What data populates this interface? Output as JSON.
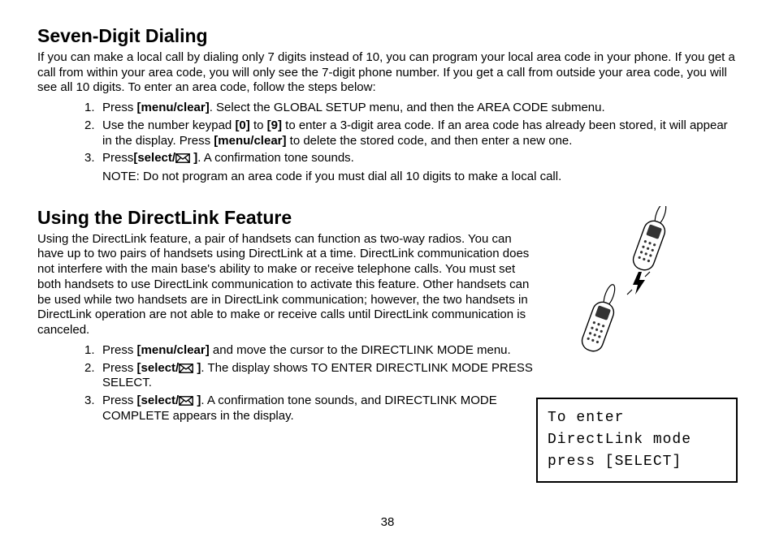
{
  "section1": {
    "heading": "Seven-Digit Dialing",
    "intro": "If you can make a local call by dialing only 7 digits instead of 10, you can program your local area code in your phone. If you get a call from within your area code, you will only see the 7-digit phone number. If you get a call from outside your area code, you will see all 10 digits. To enter an area code, follow the steps below:",
    "steps": [
      {
        "parts": [
          {
            "t": "text",
            "v": "Press "
          },
          {
            "t": "bold",
            "v": "[menu/clear]"
          },
          {
            "t": "text",
            "v": ". Select the GLOBAL SETUP menu, and then the AREA CODE submenu."
          }
        ]
      },
      {
        "parts": [
          {
            "t": "text",
            "v": "Use the number keypad "
          },
          {
            "t": "bold",
            "v": "[0]"
          },
          {
            "t": "text",
            "v": " to "
          },
          {
            "t": "bold",
            "v": "[9]"
          },
          {
            "t": "text",
            "v": " to enter a 3-digit area code. If an area code has already been stored, it will appear in the display. Press "
          },
          {
            "t": "bold",
            "v": "[menu/clear]"
          },
          {
            "t": "text",
            "v": " to delete the stored code, and then enter a new one."
          }
        ]
      },
      {
        "parts": [
          {
            "t": "text",
            "v": "Press"
          },
          {
            "t": "selectkey"
          },
          {
            "t": "text",
            "v": ". A confirmation tone sounds."
          }
        ],
        "note": "NOTE: Do not program an area code if you must dial all 10 digits to make a local call."
      }
    ]
  },
  "section2": {
    "heading": "Using the DirectLink Feature",
    "intro": "Using the DirectLink feature, a pair of handsets can function as two-way radios. You can have up to two pairs of handsets using DirectLink at a time. DirectLink communication does not interfere with the main base's ability to make or receive telephone calls. You must set both handsets to use DirectLink communication to activate this feature. Other handsets can be used while two handsets are in DirectLink communication; however, the two handsets in DirectLink operation are not able to make or receive calls until DirectLink communication is canceled.",
    "steps": [
      {
        "parts": [
          {
            "t": "text",
            "v": "Press "
          },
          {
            "t": "bold",
            "v": "[menu/clear]"
          },
          {
            "t": "text",
            "v": " and move the cursor to the DIRECTLINK MODE menu."
          }
        ]
      },
      {
        "parts": [
          {
            "t": "text",
            "v": "Press "
          },
          {
            "t": "selectkey"
          },
          {
            "t": "text",
            "v": ". The display shows TO ENTER DIRECTLINK MODE PRESS SELECT."
          }
        ]
      },
      {
        "parts": [
          {
            "t": "text",
            "v": "Press "
          },
          {
            "t": "selectkey"
          },
          {
            "t": "text",
            "v": ". A confirmation tone sounds, and DIRECTLINK MODE COMPLETE appears in the display."
          }
        ]
      }
    ]
  },
  "display": {
    "line1": "To enter",
    "line2": "DirectLink mode",
    "line3": "press [SELECT]"
  },
  "selectLabel": {
    "pre": "[select/",
    "post": " ]"
  },
  "pageNumber": "38"
}
